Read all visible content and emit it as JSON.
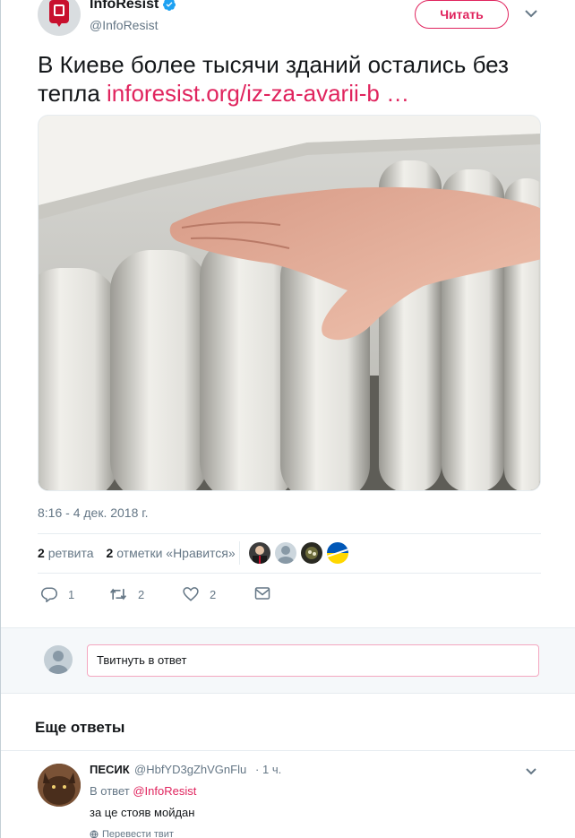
{
  "author": {
    "name": "InfoResist",
    "handle": "@InfoResist",
    "verified": true
  },
  "follow_button": {
    "label": "Читать"
  },
  "tweet": {
    "text": "В Киеве более тысячи зданий остались без тепла ",
    "link": "inforesist.org/iz-za-avarii-b  …",
    "timestamp": "8:16 - 4 дек. 2018 г."
  },
  "stats": {
    "retweets_count": "2",
    "retweets_label": "ретвита",
    "likes_count": "2",
    "likes_label": "отметки «Нравится»"
  },
  "actions": {
    "reply_count": "1",
    "retweet_count": "2",
    "like_count": "2"
  },
  "reply_box": {
    "placeholder": "Твитнуть в ответ"
  },
  "more_replies": {
    "title": "Еще ответы"
  },
  "reply": {
    "name": "ПЕСИК",
    "handle": "@HbfYD3gZhVGnFlu",
    "separator": "·",
    "time": "1 ч.",
    "reply_to_prefix": "В ответ",
    "reply_to_mention": "@InfoResist",
    "text": "за це стояв мойдан",
    "translate": "Перевести твит"
  },
  "colors": {
    "accent": "#e0245e",
    "verified": "#1da1f2",
    "muted": "#657786",
    "brand_red": "#c8102e"
  }
}
